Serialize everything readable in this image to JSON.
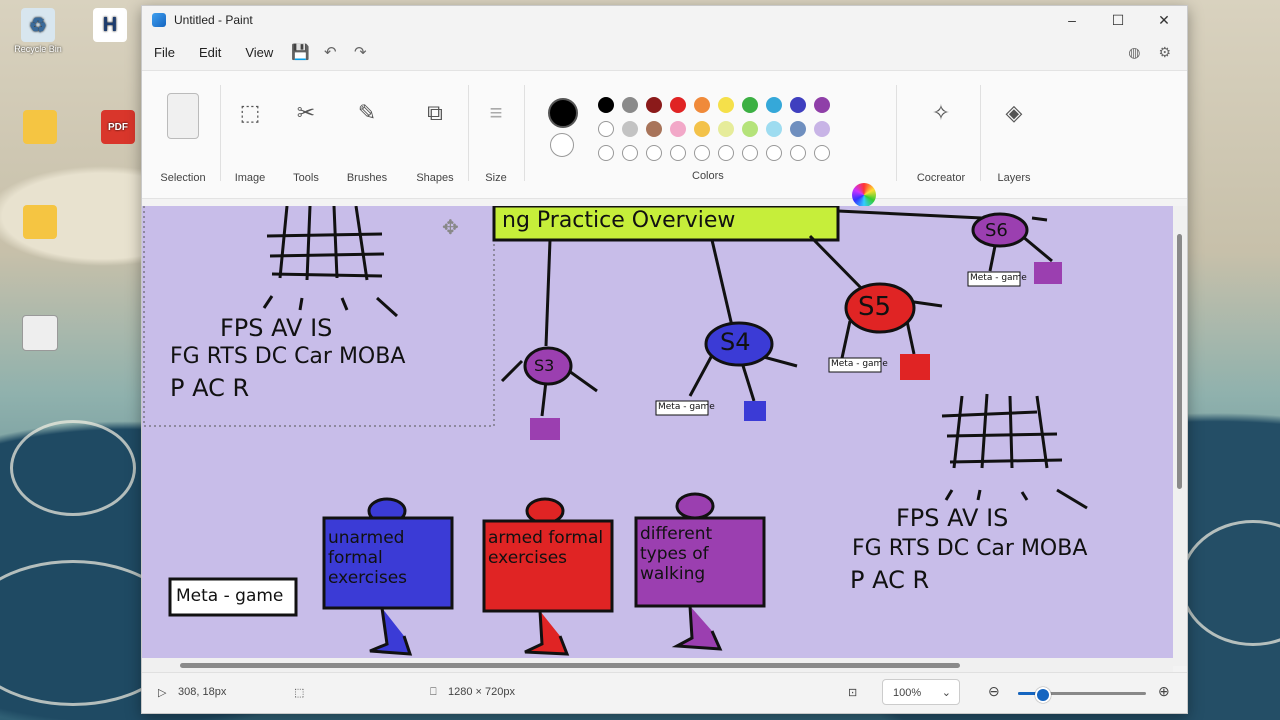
{
  "window": {
    "title": "Untitled - Paint"
  },
  "menu": {
    "file": "File",
    "edit": "Edit",
    "view": "View"
  },
  "ribbon": {
    "selection": "Selection",
    "image": "Image",
    "tools": "Tools",
    "brushes": "Brushes",
    "shapes": "Shapes",
    "size": "Size",
    "colors": "Colors",
    "cocreator": "Cocreator",
    "layers": "Layers"
  },
  "colors": {
    "primary": "#000000",
    "secondary": "#ffffff",
    "row1": [
      "#000000",
      "#8a8a8a",
      "#8b1a1a",
      "#e02424",
      "#f08a3a",
      "#f5e04a",
      "#3cb043",
      "#35a8d9",
      "#3f3fbf",
      "#8f3fa8"
    ],
    "row2": [
      "#ffffff",
      "#c3c3c3",
      "#a8745a",
      "#f2a8c8",
      "#f3c24a",
      "#e6ec9a",
      "#b5e37a",
      "#9edcf0",
      "#6f8fbf",
      "#c8b4e6"
    ],
    "row3": [
      "#ffffff",
      "#ffffff",
      "#ffffff",
      "#ffffff",
      "#ffffff",
      "#ffffff",
      "#ffffff",
      "#ffffff",
      "#ffffff",
      "#ffffff"
    ]
  },
  "status": {
    "cursor_pos": "308, 18px",
    "canvas_size": "1280 × 720px",
    "zoom": "100%",
    "zoom_fraction": 0.18
  },
  "drawing": {
    "header": "ng Practice Overview",
    "genres_line1": "FPS  AV IS",
    "genres_line2": "FG RTS DC Car MOBA",
    "genres_line3": "P AC R",
    "nodes": [
      "S3",
      "S4",
      "S5",
      "S6"
    ],
    "meta_label": "Meta - game",
    "tiny_label": "Meta - game",
    "card_blue": "unarmed formal exercises",
    "card_red": "armed formal exercises",
    "card_purple": "different types of walking"
  },
  "desktop": {
    "icon1": "Recycle Bin",
    "icon2": "H"
  }
}
